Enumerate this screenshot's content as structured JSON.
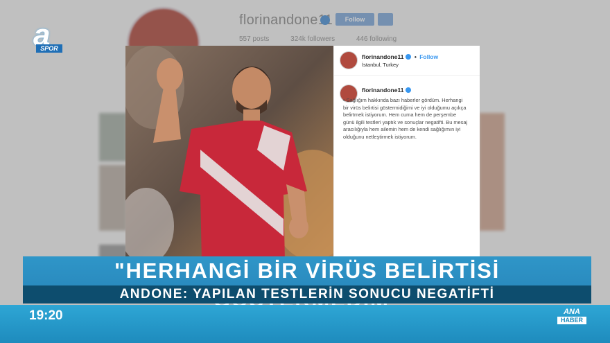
{
  "background_profile": {
    "username": "florinandone11",
    "follow_label": "Follow",
    "stats": {
      "posts": "557 posts",
      "followers": "324k followers",
      "following": "446 following"
    }
  },
  "channel": {
    "logo_letter": "a",
    "logo_sub": "SPOR"
  },
  "post": {
    "username": "florinandone11",
    "follow_label": "Follow",
    "separator": "•",
    "location": "İstanbul, Turkey",
    "comment_username": "florinandone11",
    "caption": "• Sağlığım hakkında bazı haberler gördüm. Herhangi bir virüs belirtisi göstermidiğimi ve iyi olduğumu açıkça belirtmek istiyorum. Hem cuma hem de perşembe günü ilgili testleri yaptık ve sonuçlar negatifti. Bu mesaj aracılığıyla hem ailemin hem de kendi sağlığımın iyi olduğunu netleştirmek istiyorum."
  },
  "lower_third": {
    "headline": "\"HERHANGİ BİR VİRÜS BELİRTİSİ GÖSTERMEDİM\"",
    "subline": "ANDONE: YAPILAN TESTLERİN SONUCU NEGATİFTİ"
  },
  "ticker": {
    "time": "19:20",
    "brand_top": "ANA",
    "brand_bottom": "HABER"
  },
  "colors": {
    "band_main": "#2f96c8",
    "band_sub": "#0d4d6e",
    "ticker": "#2ea6d5",
    "instagram_blue": "#3897f0"
  }
}
